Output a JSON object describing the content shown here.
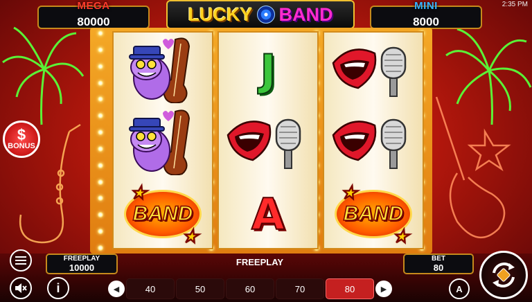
{
  "status": {
    "time": "2:35 PM"
  },
  "logo": {
    "word1": "LUCKY",
    "word2": "BAND"
  },
  "jackpots": {
    "mega": {
      "label": "MEGA",
      "value": "80000"
    },
    "mini": {
      "label": "MINI",
      "value": "8000"
    }
  },
  "reels": [
    {
      "symbols": [
        "frog-bassist",
        "frog-bassist",
        "band"
      ]
    },
    {
      "symbols": [
        "J",
        "lips-microphone",
        "A"
      ]
    },
    {
      "symbols": [
        "lips-microphone",
        "lips-microphone",
        "band"
      ]
    }
  ],
  "symbol_text": {
    "band": "BAND",
    "J": "J",
    "A": "A"
  },
  "side": {
    "bonus_label": "BONUS",
    "bonus_symbol": "$"
  },
  "bottom": {
    "freeplay": {
      "label": "FREEPLAY",
      "value": "10000"
    },
    "mode_label": "FREEPLAY",
    "bet": {
      "label": "BET",
      "value": "80"
    },
    "bet_options": [
      "40",
      "50",
      "60",
      "70",
      "80"
    ],
    "selected_bet": "80",
    "auto_label": "A"
  },
  "colors": {
    "mega": "#ff3b2c",
    "mini": "#36b4ff",
    "frame": "#e07d10",
    "selected_bet": "#c52020"
  }
}
